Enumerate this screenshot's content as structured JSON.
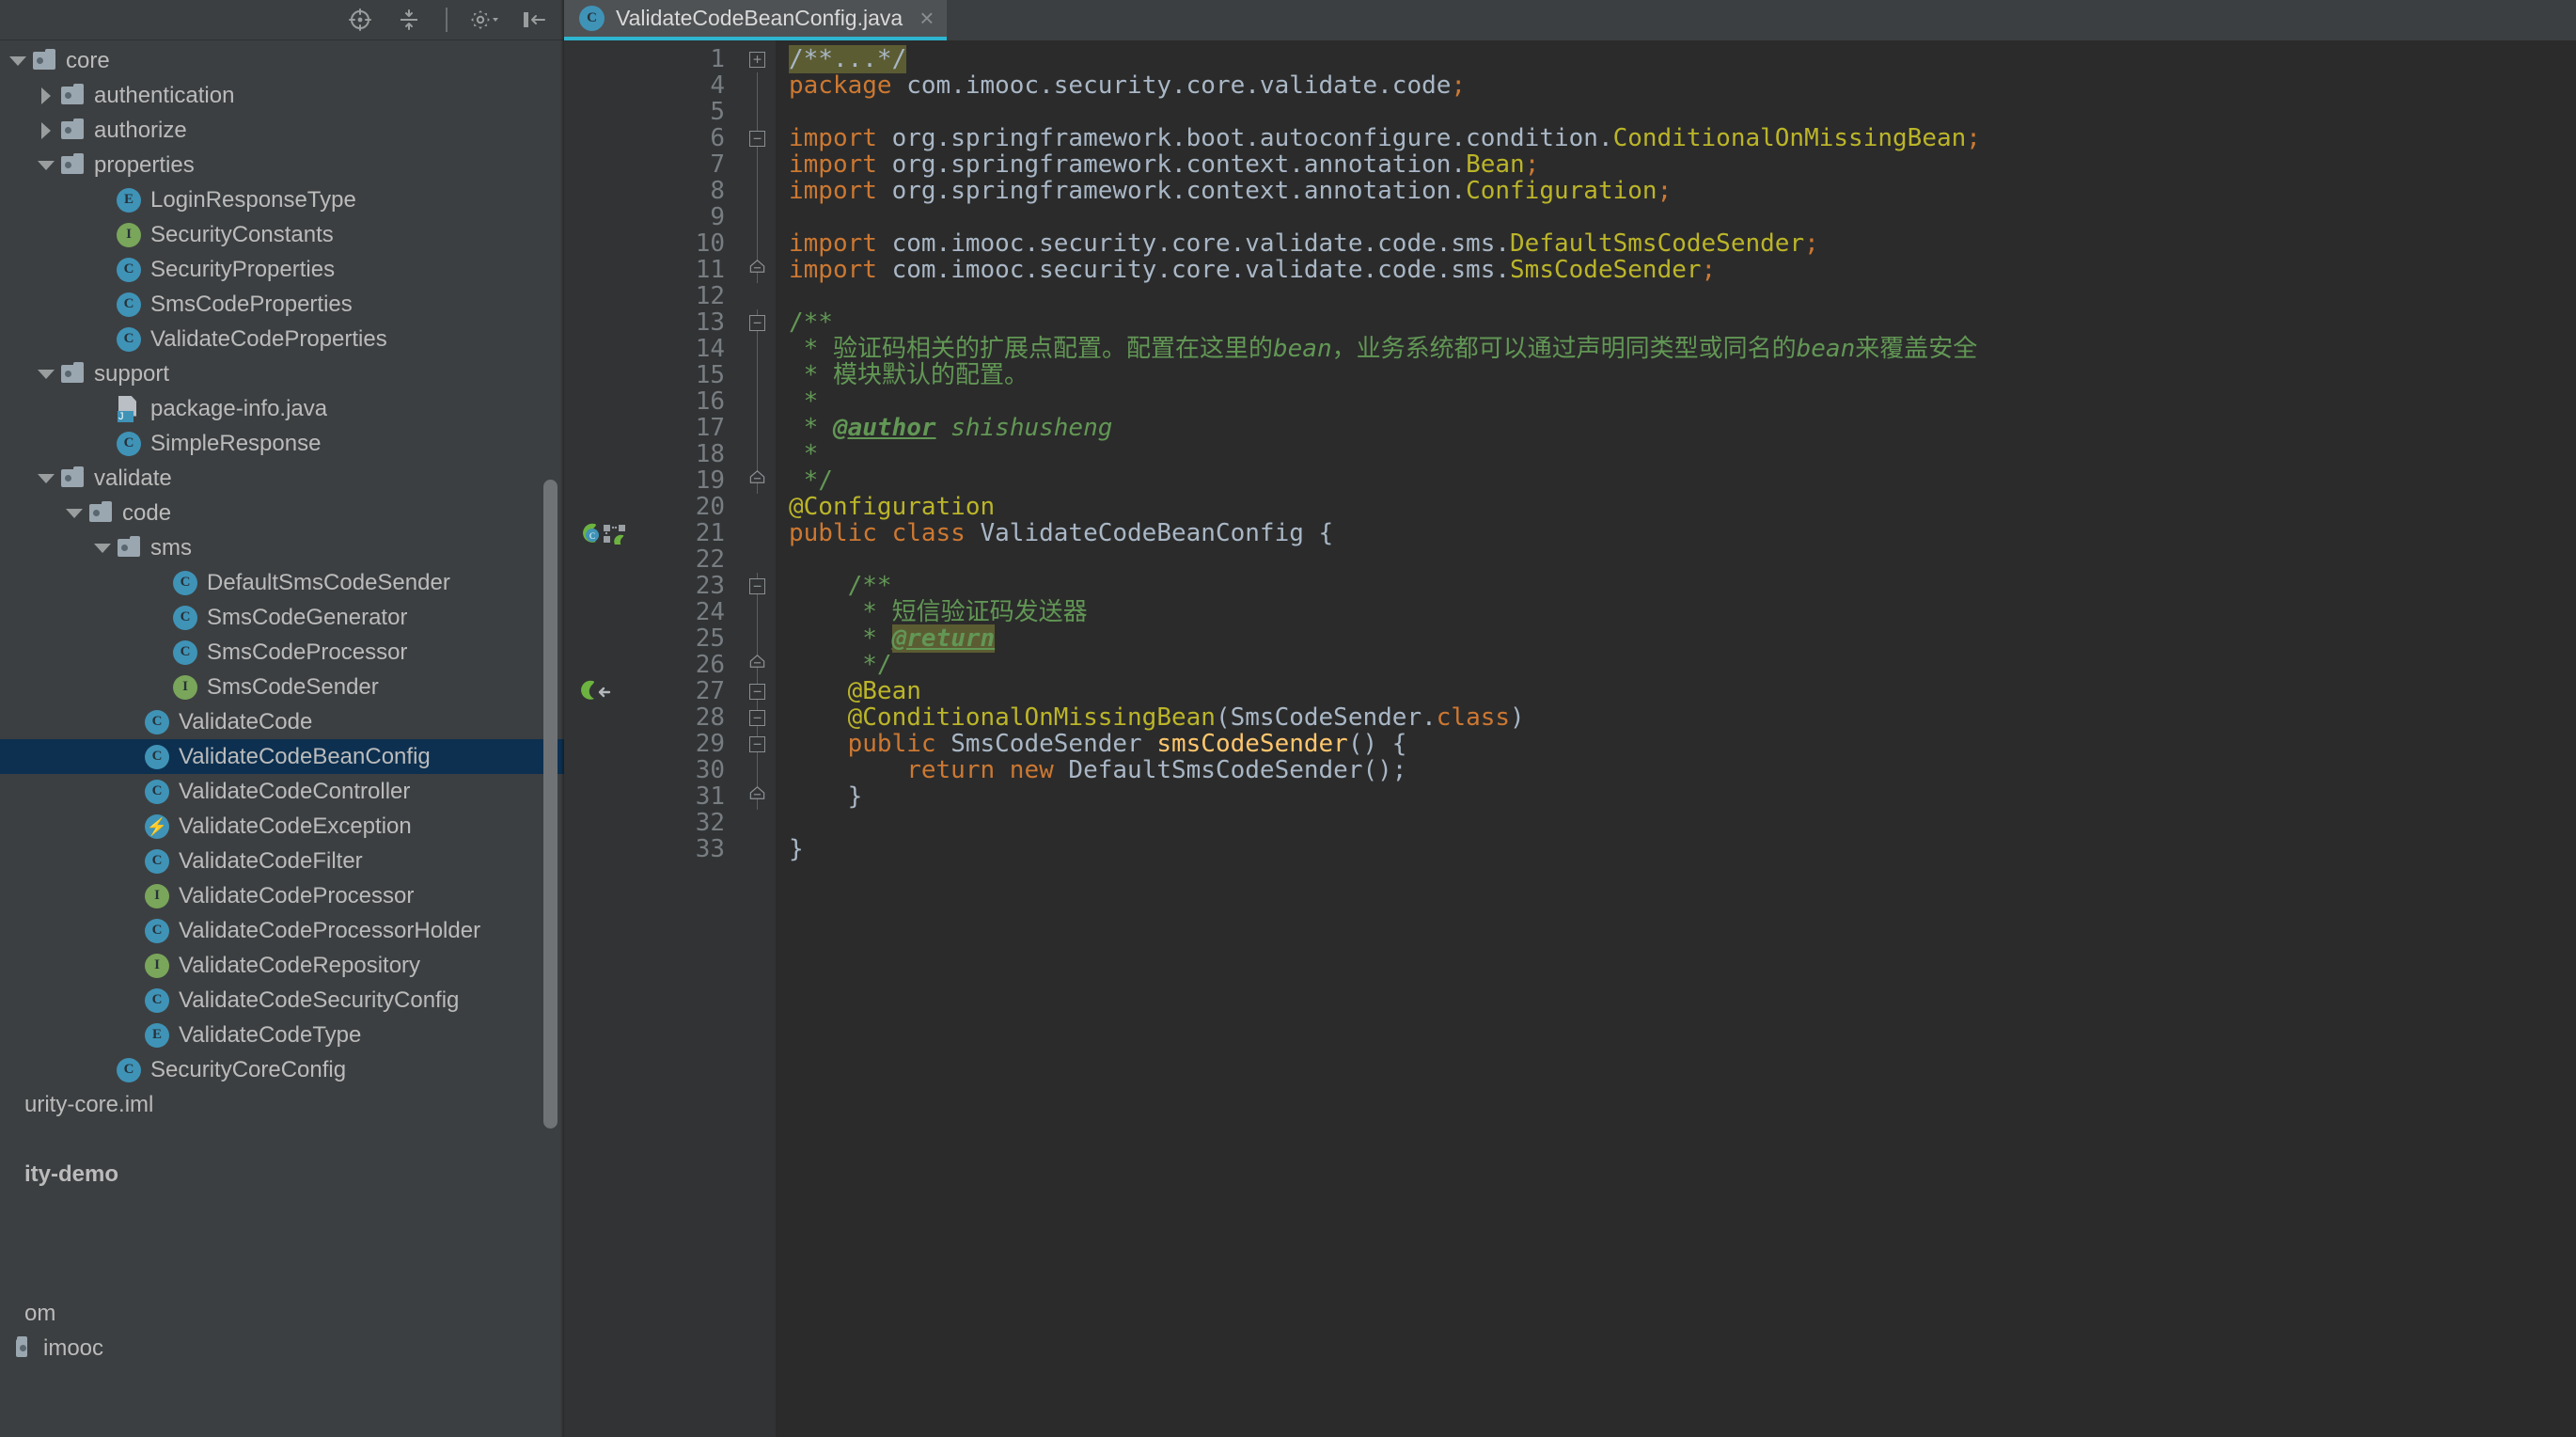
{
  "sidebar": {
    "toolbar": {
      "icons": [
        {
          "name": "locate-icon",
          "title": "Select Opened File"
        },
        {
          "name": "collapse-all-icon",
          "title": "Collapse All"
        },
        {
          "name": "settings-gear-icon",
          "title": "Settings"
        },
        {
          "name": "hide-panel-icon",
          "title": "Hide"
        }
      ]
    },
    "tree": [
      {
        "label": "core",
        "kind": "folder",
        "arrow": "down",
        "indent": 0
      },
      {
        "label": "authentication",
        "kind": "folder",
        "arrow": "right",
        "indent": 1
      },
      {
        "label": "authorize",
        "kind": "folder",
        "arrow": "right",
        "indent": 1
      },
      {
        "label": "properties",
        "kind": "folder",
        "arrow": "down",
        "indent": 1
      },
      {
        "label": "LoginResponseType",
        "kind": "enum",
        "arrow": "none",
        "indent": 3
      },
      {
        "label": "SecurityConstants",
        "kind": "interface",
        "arrow": "none",
        "indent": 3
      },
      {
        "label": "SecurityProperties",
        "kind": "class",
        "arrow": "none",
        "indent": 3
      },
      {
        "label": "SmsCodeProperties",
        "kind": "class",
        "arrow": "none",
        "indent": 3
      },
      {
        "label": "ValidateCodeProperties",
        "kind": "class",
        "arrow": "none",
        "indent": 3
      },
      {
        "label": "support",
        "kind": "folder",
        "arrow": "down",
        "indent": 1
      },
      {
        "label": "package-info.java",
        "kind": "javafile",
        "arrow": "none",
        "indent": 3
      },
      {
        "label": "SimpleResponse",
        "kind": "class",
        "arrow": "none",
        "indent": 3
      },
      {
        "label": "validate",
        "kind": "folder",
        "arrow": "down",
        "indent": 1
      },
      {
        "label": "code",
        "kind": "folder",
        "arrow": "down",
        "indent": 2
      },
      {
        "label": "sms",
        "kind": "folder",
        "arrow": "down",
        "indent": 3
      },
      {
        "label": "DefaultSmsCodeSender",
        "kind": "class",
        "arrow": "none",
        "indent": 5
      },
      {
        "label": "SmsCodeGenerator",
        "kind": "class",
        "arrow": "none",
        "indent": 5
      },
      {
        "label": "SmsCodeProcessor",
        "kind": "class",
        "arrow": "none",
        "indent": 5
      },
      {
        "label": "SmsCodeSender",
        "kind": "interface",
        "arrow": "none",
        "indent": 5
      },
      {
        "label": "ValidateCode",
        "kind": "class",
        "arrow": "none",
        "indent": 4
      },
      {
        "label": "ValidateCodeBeanConfig",
        "kind": "class",
        "arrow": "none",
        "indent": 4,
        "selected": true
      },
      {
        "label": "ValidateCodeController",
        "kind": "class",
        "arrow": "none",
        "indent": 4
      },
      {
        "label": "ValidateCodeException",
        "kind": "exception",
        "arrow": "none",
        "indent": 4
      },
      {
        "label": "ValidateCodeFilter",
        "kind": "class",
        "arrow": "none",
        "indent": 4
      },
      {
        "label": "ValidateCodeProcessor",
        "kind": "interface",
        "arrow": "none",
        "indent": 4
      },
      {
        "label": "ValidateCodeProcessorHolder",
        "kind": "class",
        "arrow": "none",
        "indent": 4
      },
      {
        "label": "ValidateCodeRepository",
        "kind": "interface",
        "arrow": "none",
        "indent": 4
      },
      {
        "label": "ValidateCodeSecurityConfig",
        "kind": "class",
        "arrow": "none",
        "indent": 4
      },
      {
        "label": "ValidateCodeType",
        "kind": "enum",
        "arrow": "none",
        "indent": 4
      },
      {
        "label": "SecurityCoreConfig",
        "kind": "class",
        "arrow": "none",
        "indent": 3
      },
      {
        "label": "urity-core.iml",
        "kind": "text",
        "arrow": "none",
        "indent": -1
      },
      {
        "label": "",
        "kind": "blank",
        "arrow": "none",
        "indent": 0
      },
      {
        "label": "ity-demo",
        "kind": "text-bold",
        "arrow": "none",
        "indent": -1
      },
      {
        "label": "",
        "kind": "blank",
        "arrow": "none",
        "indent": 0
      },
      {
        "label": "",
        "kind": "blank",
        "arrow": "none",
        "indent": 0
      },
      {
        "label": "",
        "kind": "blank",
        "arrow": "none",
        "indent": 0
      },
      {
        "label": "om",
        "kind": "text",
        "arrow": "none",
        "indent": -1
      },
      {
        "label": "imooc",
        "kind": "text-folder-clip",
        "arrow": "none",
        "indent": -1
      }
    ]
  },
  "editor": {
    "tab": {
      "label": "ValidateCodeBeanConfig.java",
      "icon": "class-icon",
      "close": "×",
      "accent_color": "#2eb5d0"
    },
    "lines": [
      {
        "num": "1",
        "fold": "plus",
        "gutter": "",
        "segs": [
          {
            "t": "/**...*/",
            "c": "fold-hl"
          }
        ]
      },
      {
        "num": "4",
        "fold": "line",
        "gutter": "",
        "segs": [
          {
            "t": "package ",
            "c": "kw"
          },
          {
            "t": "com.imooc.security.core.validate.code",
            "c": "id"
          },
          {
            "t": ";",
            "c": "sem"
          }
        ]
      },
      {
        "num": "5",
        "fold": "line",
        "gutter": "",
        "segs": []
      },
      {
        "num": "6",
        "fold": "minus",
        "gutter": "",
        "segs": [
          {
            "t": "import ",
            "c": "kw"
          },
          {
            "t": "org.springframework.boot.autoconfigure.condition.",
            "c": "id"
          },
          {
            "t": "ConditionalOnMissingBean",
            "c": "cn"
          },
          {
            "t": ";",
            "c": "sem"
          }
        ]
      },
      {
        "num": "7",
        "fold": "line",
        "gutter": "",
        "segs": [
          {
            "t": "import ",
            "c": "kw"
          },
          {
            "t": "org.springframework.context.annotation.",
            "c": "id"
          },
          {
            "t": "Bean",
            "c": "cn"
          },
          {
            "t": ";",
            "c": "sem"
          }
        ]
      },
      {
        "num": "8",
        "fold": "line",
        "gutter": "",
        "segs": [
          {
            "t": "import ",
            "c": "kw"
          },
          {
            "t": "org.springframework.context.annotation.",
            "c": "id"
          },
          {
            "t": "Configuration",
            "c": "cn"
          },
          {
            "t": ";",
            "c": "sem"
          }
        ]
      },
      {
        "num": "9",
        "fold": "line",
        "gutter": "",
        "segs": []
      },
      {
        "num": "10",
        "fold": "line",
        "gutter": "",
        "segs": [
          {
            "t": "import ",
            "c": "kw"
          },
          {
            "t": "com.imooc.security.core.validate.code.sms.",
            "c": "id"
          },
          {
            "t": "DefaultSmsCodeSender",
            "c": "cn"
          },
          {
            "t": ";",
            "c": "sem"
          }
        ]
      },
      {
        "num": "11",
        "fold": "endtop",
        "gutter": "",
        "segs": [
          {
            "t": "import ",
            "c": "kw"
          },
          {
            "t": "com.imooc.security.core.validate.code.sms.",
            "c": "id"
          },
          {
            "t": "SmsCodeSender",
            "c": "cn"
          },
          {
            "t": ";",
            "c": "sem"
          }
        ]
      },
      {
        "num": "12",
        "fold": "none",
        "gutter": "",
        "segs": []
      },
      {
        "num": "13",
        "fold": "minus",
        "gutter": "",
        "segs": [
          {
            "t": "/**",
            "c": "cmt"
          }
        ]
      },
      {
        "num": "14",
        "fold": "line",
        "gutter": "",
        "segs": [
          {
            "t": " * ",
            "c": "cmt"
          },
          {
            "t": "验证码相关的扩展点配置。配置在这里的",
            "c": "cmt"
          },
          {
            "t": "bean",
            "c": "cmt-i"
          },
          {
            "t": "，业务系统都可以通过声明同类型或同名的",
            "c": "cmt"
          },
          {
            "t": "bean",
            "c": "cmt-i"
          },
          {
            "t": "来覆盖安全",
            "c": "cmt"
          }
        ]
      },
      {
        "num": "15",
        "fold": "line",
        "gutter": "",
        "segs": [
          {
            "t": " * ",
            "c": "cmt"
          },
          {
            "t": "模块默认的配置。",
            "c": "cmt"
          }
        ]
      },
      {
        "num": "16",
        "fold": "line",
        "gutter": "",
        "segs": [
          {
            "t": " *",
            "c": "cmt"
          }
        ]
      },
      {
        "num": "17",
        "fold": "line",
        "gutter": "",
        "segs": [
          {
            "t": " * ",
            "c": "cmt"
          },
          {
            "t": "@author",
            "c": "cmt-tag"
          },
          {
            "t": " ",
            "c": "cmt"
          },
          {
            "t": "shishusheng",
            "c": "cmt-i"
          }
        ]
      },
      {
        "num": "18",
        "fold": "line",
        "gutter": "",
        "segs": [
          {
            "t": " *",
            "c": "cmt"
          }
        ]
      },
      {
        "num": "19",
        "fold": "endtop",
        "gutter": "",
        "segs": [
          {
            "t": " */",
            "c": "cmt"
          }
        ]
      },
      {
        "num": "20",
        "fold": "none",
        "gutter": "",
        "segs": [
          {
            "t": "@Configuration",
            "c": "ann"
          }
        ]
      },
      {
        "num": "21",
        "fold": "none",
        "gutter": "spring-bean-config",
        "segs": [
          {
            "t": "public class ",
            "c": "kw"
          },
          {
            "t": "ValidateCodeBeanConfig",
            "c": "id"
          },
          {
            "t": " {",
            "c": "punct"
          }
        ]
      },
      {
        "num": "22",
        "fold": "none",
        "gutter": "",
        "segs": []
      },
      {
        "num": "23",
        "fold": "minus",
        "gutter": "",
        "segs": [
          {
            "t": "    /**",
            "c": "cmt"
          }
        ]
      },
      {
        "num": "24",
        "fold": "line",
        "gutter": "",
        "segs": [
          {
            "t": "     * ",
            "c": "cmt"
          },
          {
            "t": "短信验证码发送器",
            "c": "cmt"
          }
        ]
      },
      {
        "num": "25",
        "fold": "line",
        "gutter": "",
        "segs": [
          {
            "t": "     * ",
            "c": "cmt"
          },
          {
            "t": "@return",
            "c": "cmt-tag-hl"
          }
        ]
      },
      {
        "num": "26",
        "fold": "endtop",
        "gutter": "",
        "segs": [
          {
            "t": "     */",
            "c": "cmt"
          }
        ]
      },
      {
        "num": "27",
        "fold": "minus",
        "gutter": "spring-bean",
        "segs": [
          {
            "t": "    @Bean",
            "c": "ann"
          }
        ]
      },
      {
        "num": "28",
        "fold": "minus",
        "gutter": "",
        "segs": [
          {
            "t": "    @ConditionalOnMissingBean",
            "c": "ann"
          },
          {
            "t": "(",
            "c": "punct"
          },
          {
            "t": "SmsCodeSender.",
            "c": "id"
          },
          {
            "t": "class",
            "c": "kw"
          },
          {
            "t": ")",
            "c": "punct"
          }
        ]
      },
      {
        "num": "29",
        "fold": "minus",
        "gutter": "",
        "segs": [
          {
            "t": "    public ",
            "c": "kw"
          },
          {
            "t": "SmsCodeSender ",
            "c": "id"
          },
          {
            "t": "smsCodeSender",
            "c": "mth"
          },
          {
            "t": "() {",
            "c": "punct"
          }
        ]
      },
      {
        "num": "30",
        "fold": "line",
        "gutter": "",
        "segs": [
          {
            "t": "        return new ",
            "c": "kw"
          },
          {
            "t": "DefaultSmsCodeSender",
            "c": "id"
          },
          {
            "t": "();",
            "c": "punct"
          }
        ]
      },
      {
        "num": "31",
        "fold": "endtop",
        "gutter": "",
        "segs": [
          {
            "t": "    }",
            "c": "punct"
          }
        ]
      },
      {
        "num": "32",
        "fold": "none",
        "gutter": "",
        "segs": []
      },
      {
        "num": "33",
        "fold": "none",
        "gutter": "",
        "segs": [
          {
            "t": "}",
            "c": "punct"
          }
        ]
      }
    ]
  },
  "colors": {
    "editor_bg": "#2b2b2b",
    "gutter_bg": "#313335",
    "panel_bg": "#3c3f41",
    "selection_bg": "#0d3050",
    "keyword": "#cc7832",
    "annotation": "#bbb529",
    "comment": "#629755",
    "identifier": "#a9b7c6",
    "method": "#ffc66d",
    "fold_highlight": "#5c5c33"
  }
}
